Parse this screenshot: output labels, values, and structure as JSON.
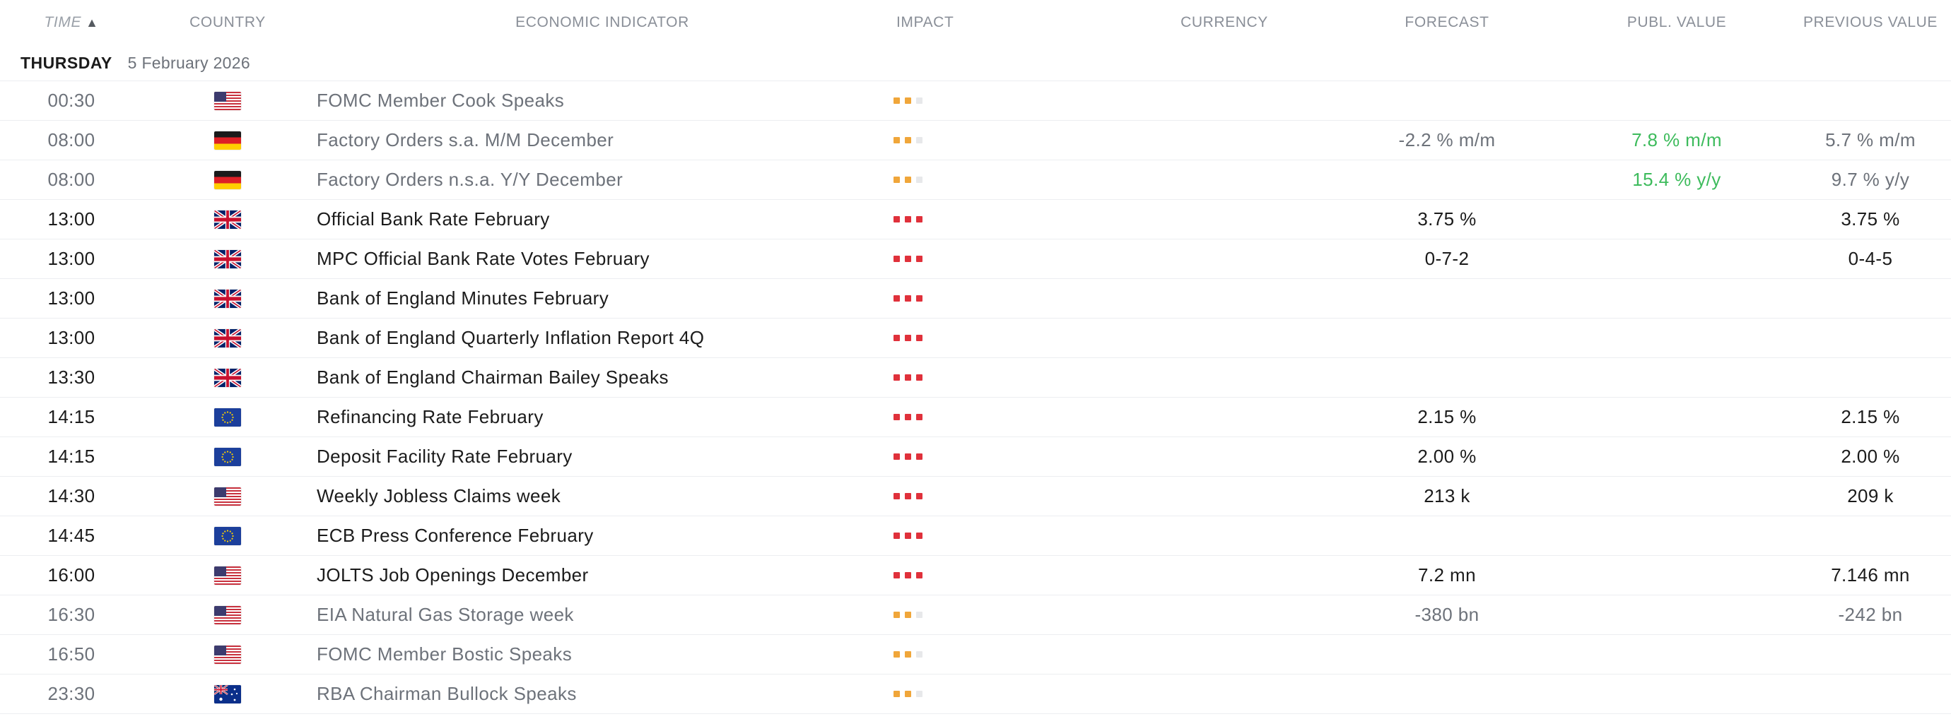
{
  "header": {
    "time": "TIME",
    "sort_arrow": "▲",
    "country": "COUNTRY",
    "indicator": "ECONOMIC INDICATOR",
    "impact": "IMPACT",
    "currency": "CURRENCY",
    "forecast": "FORECAST",
    "publ_value": "PUBL. VALUE",
    "previous_value": "PREVIOUS VALUE"
  },
  "day": {
    "weekday": "THURSDAY",
    "date": "5 February 2026"
  },
  "colors": {
    "impact_high": "#e0313b",
    "impact_medium": "#f0a63a",
    "impact_off": "#e7e8ea",
    "publ_positive": "#3dbb5c"
  },
  "rows": [
    {
      "time": "00:30",
      "flag": "us-flag",
      "indicator": "FOMC Member Cook Speaks",
      "impact": 2,
      "currency": "",
      "forecast": "",
      "publ": "",
      "previous": ""
    },
    {
      "time": "08:00",
      "flag": "de-flag",
      "indicator": "Factory Orders s.a. M/M December",
      "impact": 2,
      "currency": "",
      "forecast": "-2.2 % m/m",
      "publ": "7.8 % m/m",
      "previous": "5.7 % m/m"
    },
    {
      "time": "08:00",
      "flag": "de-flag",
      "indicator": "Factory Orders n.s.a. Y/Y December",
      "impact": 2,
      "currency": "",
      "forecast": "",
      "publ": "15.4 % y/y",
      "previous": "9.7 % y/y"
    },
    {
      "time": "13:00",
      "flag": "uk-flag",
      "indicator": "Official Bank Rate February",
      "impact": 3,
      "currency": "",
      "forecast": "3.75 %",
      "publ": "",
      "previous": "3.75 %"
    },
    {
      "time": "13:00",
      "flag": "uk-flag",
      "indicator": "MPC Official Bank Rate Votes February",
      "impact": 3,
      "currency": "",
      "forecast": "0-7-2",
      "publ": "",
      "previous": "0-4-5"
    },
    {
      "time": "13:00",
      "flag": "uk-flag",
      "indicator": "Bank of England Minutes February",
      "impact": 3,
      "currency": "",
      "forecast": "",
      "publ": "",
      "previous": ""
    },
    {
      "time": "13:00",
      "flag": "uk-flag",
      "indicator": "Bank of England Quarterly Inflation Report 4Q",
      "impact": 3,
      "currency": "",
      "forecast": "",
      "publ": "",
      "previous": ""
    },
    {
      "time": "13:30",
      "flag": "uk-flag",
      "indicator": "Bank of England Chairman Bailey Speaks",
      "impact": 3,
      "currency": "",
      "forecast": "",
      "publ": "",
      "previous": ""
    },
    {
      "time": "14:15",
      "flag": "eu-flag",
      "indicator": "Refinancing Rate February",
      "impact": 3,
      "currency": "",
      "forecast": "2.15 %",
      "publ": "",
      "previous": "2.15 %"
    },
    {
      "time": "14:15",
      "flag": "eu-flag",
      "indicator": "Deposit Facility Rate February",
      "impact": 3,
      "currency": "",
      "forecast": "2.00 %",
      "publ": "",
      "previous": "2.00 %"
    },
    {
      "time": "14:30",
      "flag": "us-flag",
      "indicator": "Weekly Jobless Claims week",
      "impact": 3,
      "currency": "",
      "forecast": "213 k",
      "publ": "",
      "previous": "209 k"
    },
    {
      "time": "14:45",
      "flag": "eu-flag",
      "indicator": "ECB Press Conference February",
      "impact": 3,
      "currency": "",
      "forecast": "",
      "publ": "",
      "previous": ""
    },
    {
      "time": "16:00",
      "flag": "us-flag",
      "indicator": "JOLTS Job Openings December",
      "impact": 3,
      "currency": "",
      "forecast": "7.2 mn",
      "publ": "",
      "previous": "7.146 mn"
    },
    {
      "time": "16:30",
      "flag": "us-flag",
      "indicator": "EIA Natural Gas Storage week",
      "impact": 2,
      "currency": "",
      "forecast": "-380 bn",
      "publ": "",
      "previous": "-242 bn"
    },
    {
      "time": "16:50",
      "flag": "us-flag",
      "indicator": "FOMC Member Bostic Speaks",
      "impact": 2,
      "currency": "",
      "forecast": "",
      "publ": "",
      "previous": ""
    },
    {
      "time": "23:30",
      "flag": "au-flag",
      "indicator": "RBA Chairman Bullock Speaks",
      "impact": 2,
      "currency": "",
      "forecast": "",
      "publ": "",
      "previous": ""
    }
  ]
}
